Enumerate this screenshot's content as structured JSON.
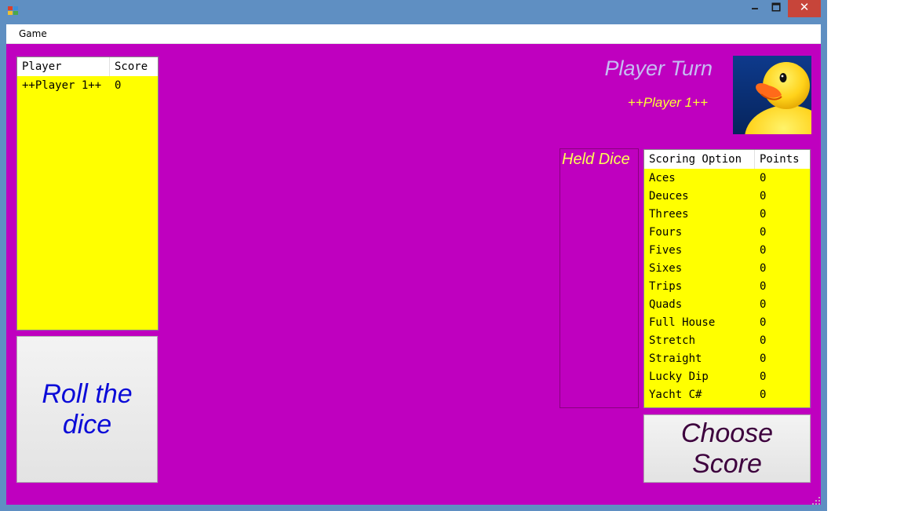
{
  "menubar": {
    "game": "Game"
  },
  "window_controls": {
    "minimize": "🗕",
    "maximize": "🗖",
    "close": "✕"
  },
  "players_table": {
    "headers": [
      "Player",
      "Score"
    ],
    "rows": [
      {
        "player": "++Player 1++",
        "score": "0"
      }
    ]
  },
  "roll_button": "Roll the dice",
  "turn": {
    "title": "Player Turn",
    "player": "++Player 1++"
  },
  "held_dice": {
    "label": "Held Dice"
  },
  "scoring_table": {
    "headers": [
      "Scoring Option",
      "Points"
    ],
    "rows": [
      {
        "option": "Aces",
        "points": "0"
      },
      {
        "option": "Deuces",
        "points": "0"
      },
      {
        "option": "Threes",
        "points": "0"
      },
      {
        "option": "Fours",
        "points": "0"
      },
      {
        "option": "Fives",
        "points": "0"
      },
      {
        "option": "Sixes",
        "points": "0"
      },
      {
        "option": "Trips",
        "points": "0"
      },
      {
        "option": "Quads",
        "points": "0"
      },
      {
        "option": "Full House",
        "points": "0"
      },
      {
        "option": "Stretch",
        "points": "0"
      },
      {
        "option": "Straight",
        "points": "0"
      },
      {
        "option": "Lucky Dip",
        "points": "0"
      },
      {
        "option": "Yacht C#",
        "points": "0"
      }
    ]
  },
  "choose_button": "Choose Score",
  "colors": {
    "background": "#bf00bf",
    "panel": "#ffff00",
    "roll_text": "#0b0bd8",
    "choose_text": "#3d003d",
    "turn_title": "#c6bdf2",
    "turn_player": "#ffff33"
  },
  "icons": {
    "app": "app-icon",
    "duck": "rubber-duck-image"
  }
}
